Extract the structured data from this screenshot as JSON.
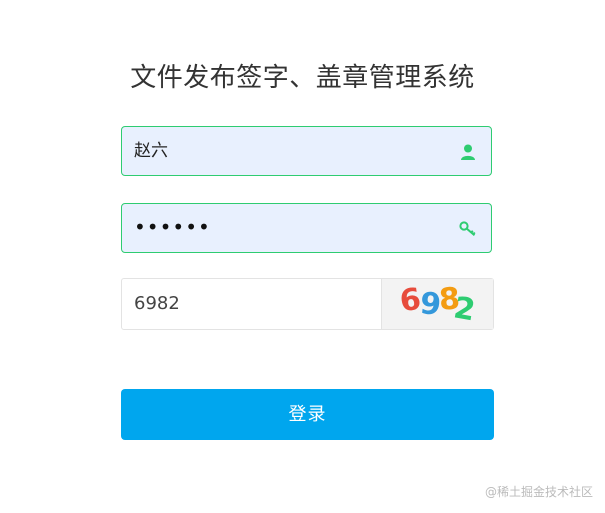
{
  "page": {
    "title": "文件发布签字、盖章管理系统"
  },
  "form": {
    "username": {
      "value": "赵六",
      "icon": "user-icon"
    },
    "password": {
      "value": "••••••",
      "icon": "key-icon"
    },
    "captcha": {
      "value": "6982",
      "image_text": [
        "6",
        "9",
        "8",
        "2"
      ]
    },
    "login_label": "登录"
  },
  "watermark": "@稀土掘金技术社区",
  "colors": {
    "accent": "#00a6ee",
    "field_border": "#2ecc71",
    "field_bg": "#e8f0fe",
    "icon": "#2ecc71"
  }
}
